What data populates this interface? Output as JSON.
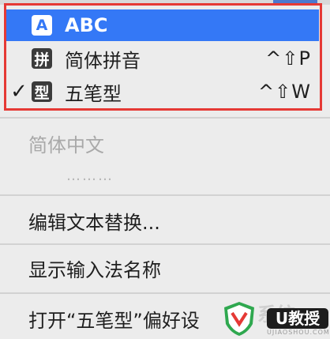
{
  "input_sources": [
    {
      "icon_char": "A",
      "label": "ABC",
      "shortcut": "",
      "selected": true,
      "checked": false
    },
    {
      "icon_char": "拼",
      "label": "简体拼音",
      "shortcut": "^⇧P",
      "selected": false,
      "checked": false
    },
    {
      "icon_char": "型",
      "label": "五笔型",
      "shortcut": "^⇧W",
      "selected": false,
      "checked": true
    }
  ],
  "check_glyph": "✓",
  "section_header": "简体中文",
  "dotted_placeholder": "………",
  "menu_items": {
    "edit_text_substitutions": "编辑文本替换...",
    "show_input_source_name": "显示输入法名称",
    "open_preferences": "打开“五笔型”偏好设"
  },
  "watermark": {
    "text": "U教授",
    "site": "UJIAOSHOU.COM",
    "faded": "系统"
  },
  "colors": {
    "selection_blue": "#3478f6",
    "highlight_red": "#e53935"
  }
}
